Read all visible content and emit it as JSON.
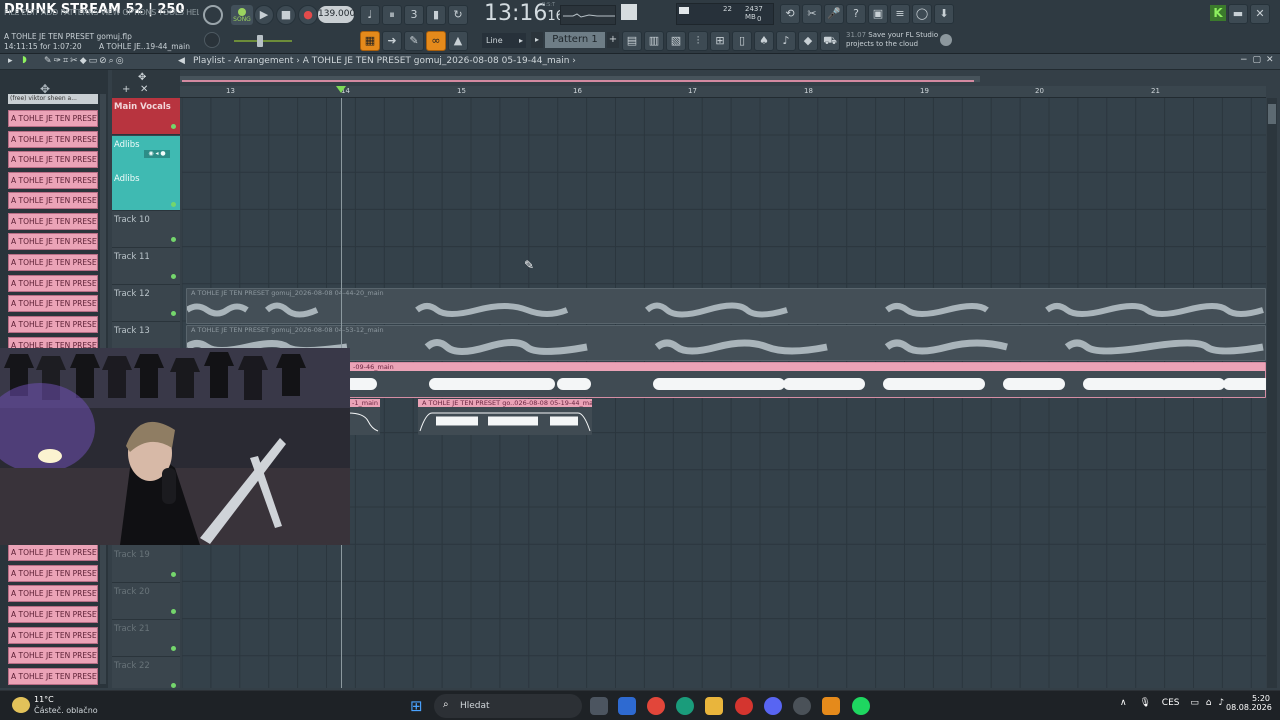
{
  "stream": {
    "title": "DRUNK STREAM 52 | 250"
  },
  "menu": {
    "items": [
      "FILE",
      "EDIT",
      "ADD",
      "PATTERNS",
      "VIEW",
      "OPTIONS",
      "TOOLS",
      "HELP"
    ]
  },
  "project": {
    "filename": "A TOHLE JE TEN PRESET gomuj.flp",
    "time_info": "14:11:15 for 1:07:20",
    "clip_hint": "A TOHLE JE..19-44_main"
  },
  "transport": {
    "mode": "SONG",
    "tempo": "139.000",
    "clock_main": "13:16",
    "clock_sub": "16",
    "clock_label": "B:S:T"
  },
  "cpu": {
    "mem": "2437 MB",
    "voices": "22",
    "zero": "0"
  },
  "snap": {
    "mode": "Line",
    "pattern": "Pattern 1"
  },
  "news": {
    "version": "31.07",
    "text1": "Save your FL Studio",
    "text2": "projects to the cloud"
  },
  "playlist": {
    "title": "Playlist - Arrangement",
    "path": "A TOHLE JE TEN PRESET gomuj_2026-08-08 05-19-44_main"
  },
  "ruler": {
    "bars": [
      "13",
      "14",
      "15",
      "16",
      "17",
      "18",
      "19",
      "20",
      "21"
    ]
  },
  "picker": {
    "header": "(free) viktor sheen a...",
    "clip_label": "A TOHLE JE TEN PRESET g"
  },
  "tracks": {
    "main_vocals": "Main Vocals",
    "adlibs_a": "Adlibs",
    "adlibs_b": "Adlibs",
    "t10": "Track 10",
    "t11": "Track 11",
    "t12": "Track 12",
    "t13": "Track 13",
    "t19": "Track 19",
    "t20": "Track 20",
    "t21": "Track 21",
    "t22": "Track 22"
  },
  "clips": {
    "c12": "A TOHLE JE TEN PRESET gomuj_2026-08-08 04-44-20_main",
    "c13": "A TOHLE JE TEN PRESET gomuj_2026-08-08 04-53-12_main",
    "c14": "-09-46_main",
    "c15a": "-1_main",
    "c15b": "A TOHLE JE TEN PRESET go..026-08-08 05-19-44_main"
  },
  "taskbar": {
    "temp": "11°C",
    "weather": "Částeč. oblačno",
    "search": "Hledat",
    "lang": "CES",
    "time": "5:20",
    "date": "08.08.2026"
  },
  "colors": {
    "accent_orange": "#e58a1b",
    "clip_pink": "#eba3b7",
    "track_red": "#b8343f",
    "track_teal": "#3fbab2",
    "clip_gray": "#8b979e"
  }
}
